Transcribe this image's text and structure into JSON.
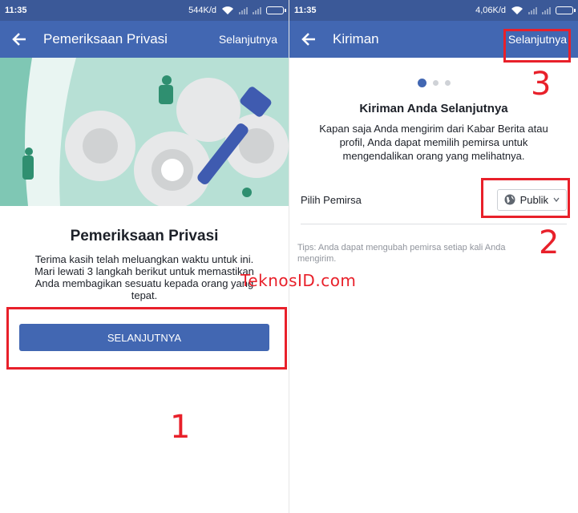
{
  "left": {
    "status": {
      "time": "11:35",
      "speed": "544K/d"
    },
    "appbar": {
      "title": "Pemeriksaan Privasi",
      "next_label": "Selanjutnya"
    },
    "content": {
      "heading": "Pemeriksaan Privasi",
      "description": "Terima kasih telah meluangkan waktu untuk ini. Mari lewati 3 langkah berikut untuk memastikan Anda membagikan sesuatu kepada orang yang tepat.",
      "button_label": "SELANJUTNYA"
    }
  },
  "right": {
    "status": {
      "time": "11:35",
      "speed": "4,06K/d"
    },
    "appbar": {
      "title": "Kiriman",
      "next_label": "Selanjutnya"
    },
    "pager": {
      "total": 3,
      "active": 1
    },
    "content": {
      "heading": "Kiriman Anda Selanjutnya",
      "description": "Kapan saja Anda mengirim dari Kabar Berita atau profil, Anda dapat memilih pemirsa untuk mengendalikan orang yang melihatnya.",
      "audience_label": "Pilih Pemirsa",
      "audience_value": "Publik",
      "tips": "Tips: Anda dapat mengubah pemirsa setiap kali Anda mengirim."
    }
  },
  "annotations": {
    "markers": [
      "1",
      "2",
      "3"
    ],
    "watermark": "TeknosID.com",
    "color": "#e8202a"
  },
  "colors": {
    "brand": "#4267b2",
    "statusbar": "#3b5998",
    "hero": "#a8d8cc"
  }
}
